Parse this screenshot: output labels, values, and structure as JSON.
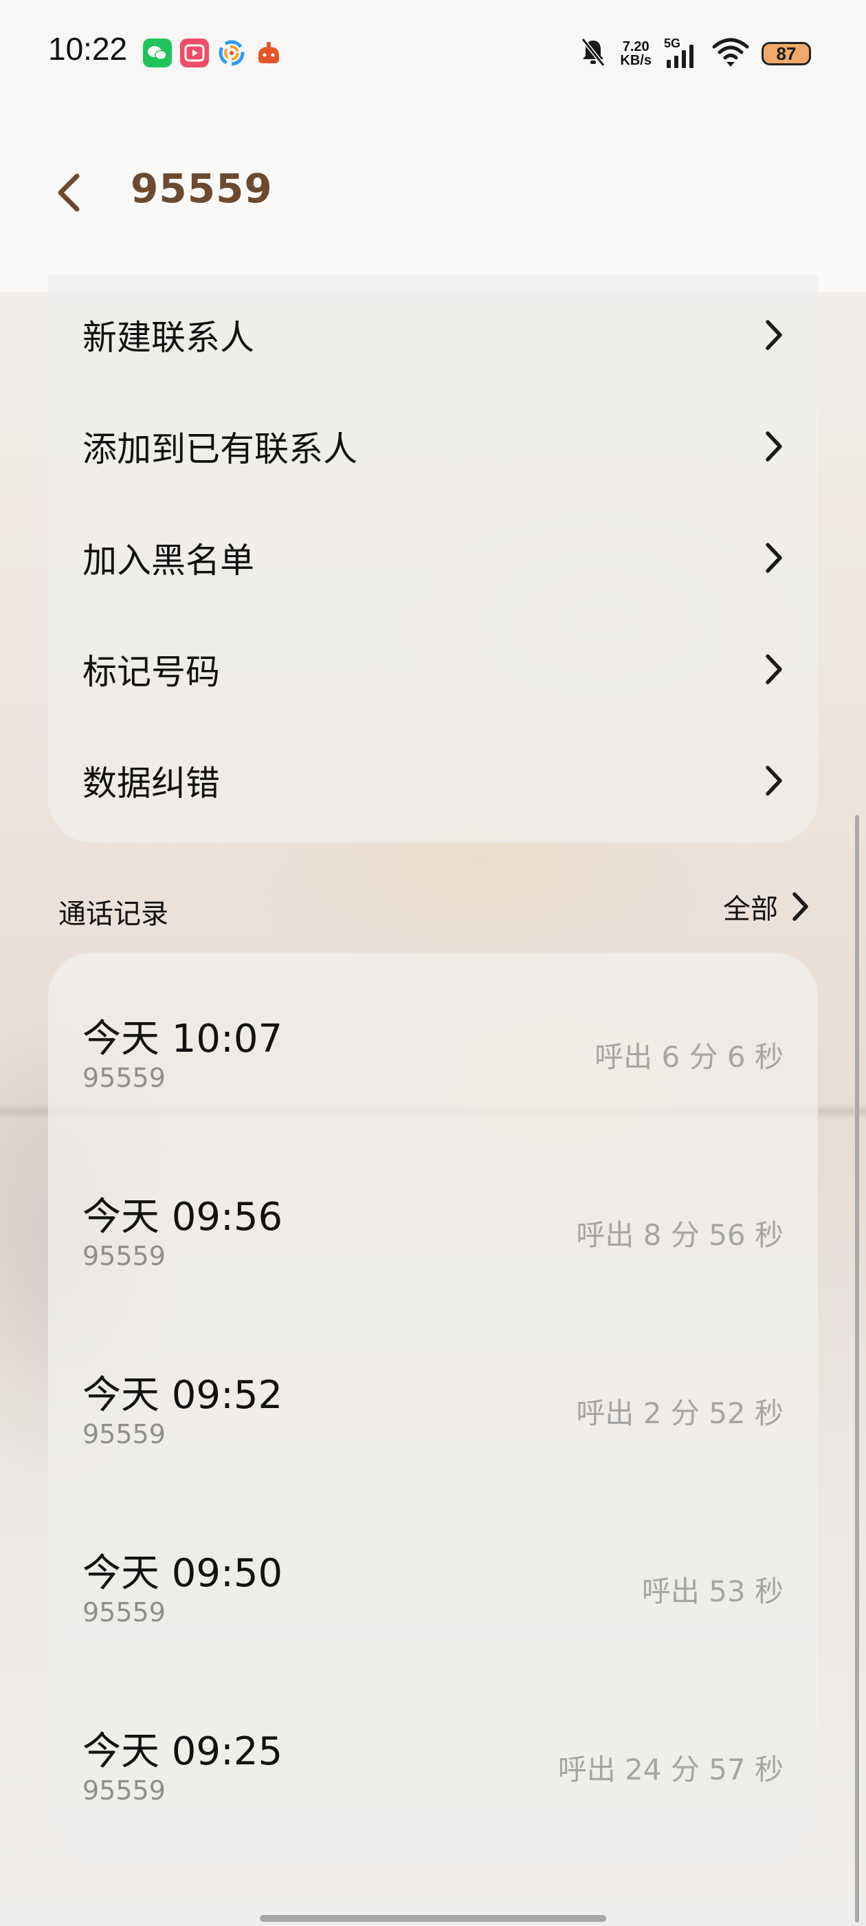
{
  "status_bar": {
    "time": "10:22",
    "net_speed_value": "7.20",
    "net_speed_unit": "KB/s",
    "network_type": "5G",
    "battery": "87",
    "icons": [
      "wechat-icon",
      "video-app-icon",
      "browser-app-icon",
      "taobao-icon",
      "mute-icon",
      "signal-icon",
      "wifi-icon",
      "battery-icon"
    ],
    "battery_color": "#f0a96a"
  },
  "header": {
    "title": "95559",
    "title_color": "#6b4a30"
  },
  "actions": [
    {
      "label": "新建联系人"
    },
    {
      "label": "添加到已有联系人"
    },
    {
      "label": "加入黑名单"
    },
    {
      "label": "标记号码"
    },
    {
      "label": "数据纠错"
    }
  ],
  "call_log": {
    "title": "通话记录",
    "all_label": "全部",
    "entries": [
      {
        "time": "今天 10:07",
        "number": "95559",
        "detail": "呼出 6 分 6 秒"
      },
      {
        "time": "今天 09:56",
        "number": "95559",
        "detail": "呼出 8 分 56 秒"
      },
      {
        "time": "今天 09:52",
        "number": "95559",
        "detail": "呼出 2 分 52 秒"
      },
      {
        "time": "今天 09:50",
        "number": "95559",
        "detail": "呼出 53 秒"
      },
      {
        "time": "今天 09:25",
        "number": "95559",
        "detail": "呼出 24 分 57 秒"
      }
    ]
  }
}
